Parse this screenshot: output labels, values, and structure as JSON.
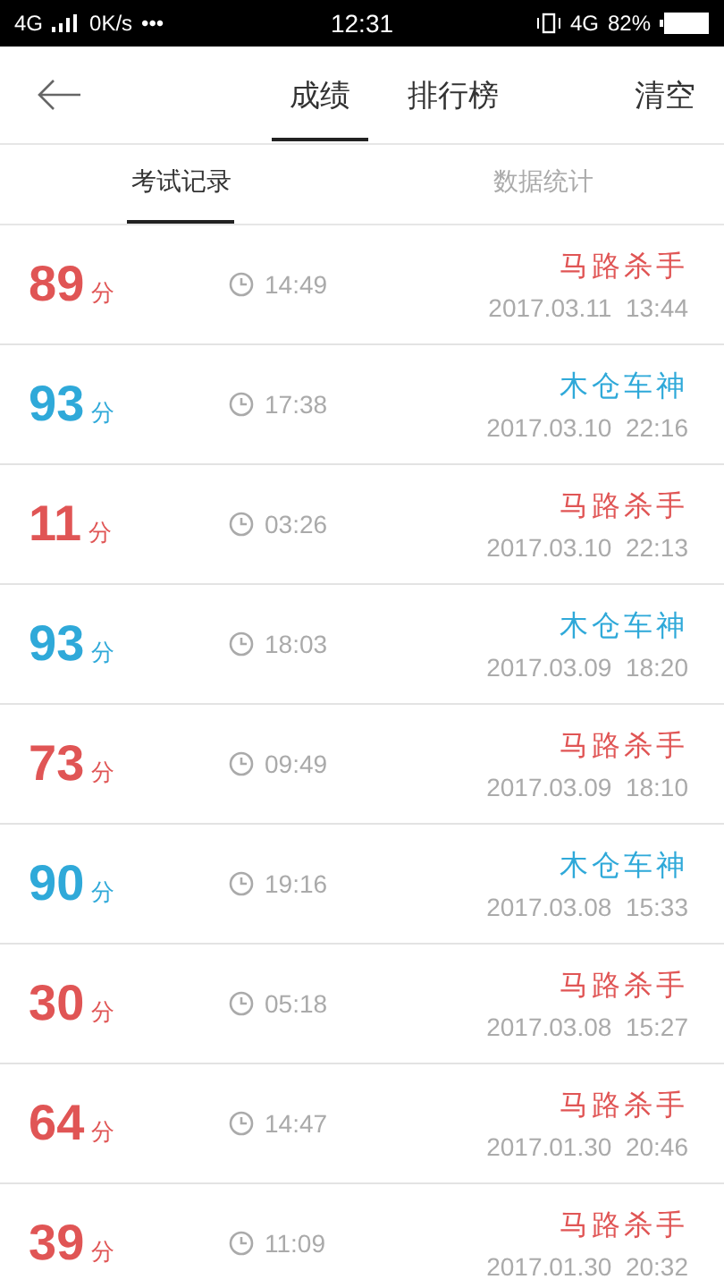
{
  "status_bar": {
    "network": "4G",
    "speed": "0K/s",
    "more": "•••",
    "time": "12:31",
    "network_right": "4G",
    "battery": "82%"
  },
  "header": {
    "tabs": [
      {
        "label": "成绩",
        "selected": true
      },
      {
        "label": "排行榜",
        "selected": false
      }
    ],
    "action": "清空"
  },
  "subtabs": [
    {
      "label": "考试记录",
      "selected": true
    },
    {
      "label": "数据统计",
      "selected": false
    }
  ],
  "records": [
    {
      "score": "89",
      "unit": "分",
      "duration": "14:49",
      "title": "马路杀手",
      "date": "2017.03.11  13:44",
      "passed": false
    },
    {
      "score": "93",
      "unit": "分",
      "duration": "17:38",
      "title": "木仓车神",
      "date": "2017.03.10  22:16",
      "passed": true
    },
    {
      "score": "11",
      "unit": "分",
      "duration": "03:26",
      "title": "马路杀手",
      "date": "2017.03.10  22:13",
      "passed": false
    },
    {
      "score": "93",
      "unit": "分",
      "duration": "18:03",
      "title": "木仓车神",
      "date": "2017.03.09  18:20",
      "passed": true
    },
    {
      "score": "73",
      "unit": "分",
      "duration": "09:49",
      "title": "马路杀手",
      "date": "2017.03.09  18:10",
      "passed": false
    },
    {
      "score": "90",
      "unit": "分",
      "duration": "19:16",
      "title": "木仓车神",
      "date": "2017.03.08  15:33",
      "passed": true
    },
    {
      "score": "30",
      "unit": "分",
      "duration": "05:18",
      "title": "马路杀手",
      "date": "2017.03.08  15:27",
      "passed": false
    },
    {
      "score": "64",
      "unit": "分",
      "duration": "14:47",
      "title": "马路杀手",
      "date": "2017.01.30  20:46",
      "passed": false
    },
    {
      "score": "39",
      "unit": "分",
      "duration": "11:09",
      "title": "马路杀手",
      "date": "2017.01.30  20:32",
      "passed": false
    }
  ]
}
